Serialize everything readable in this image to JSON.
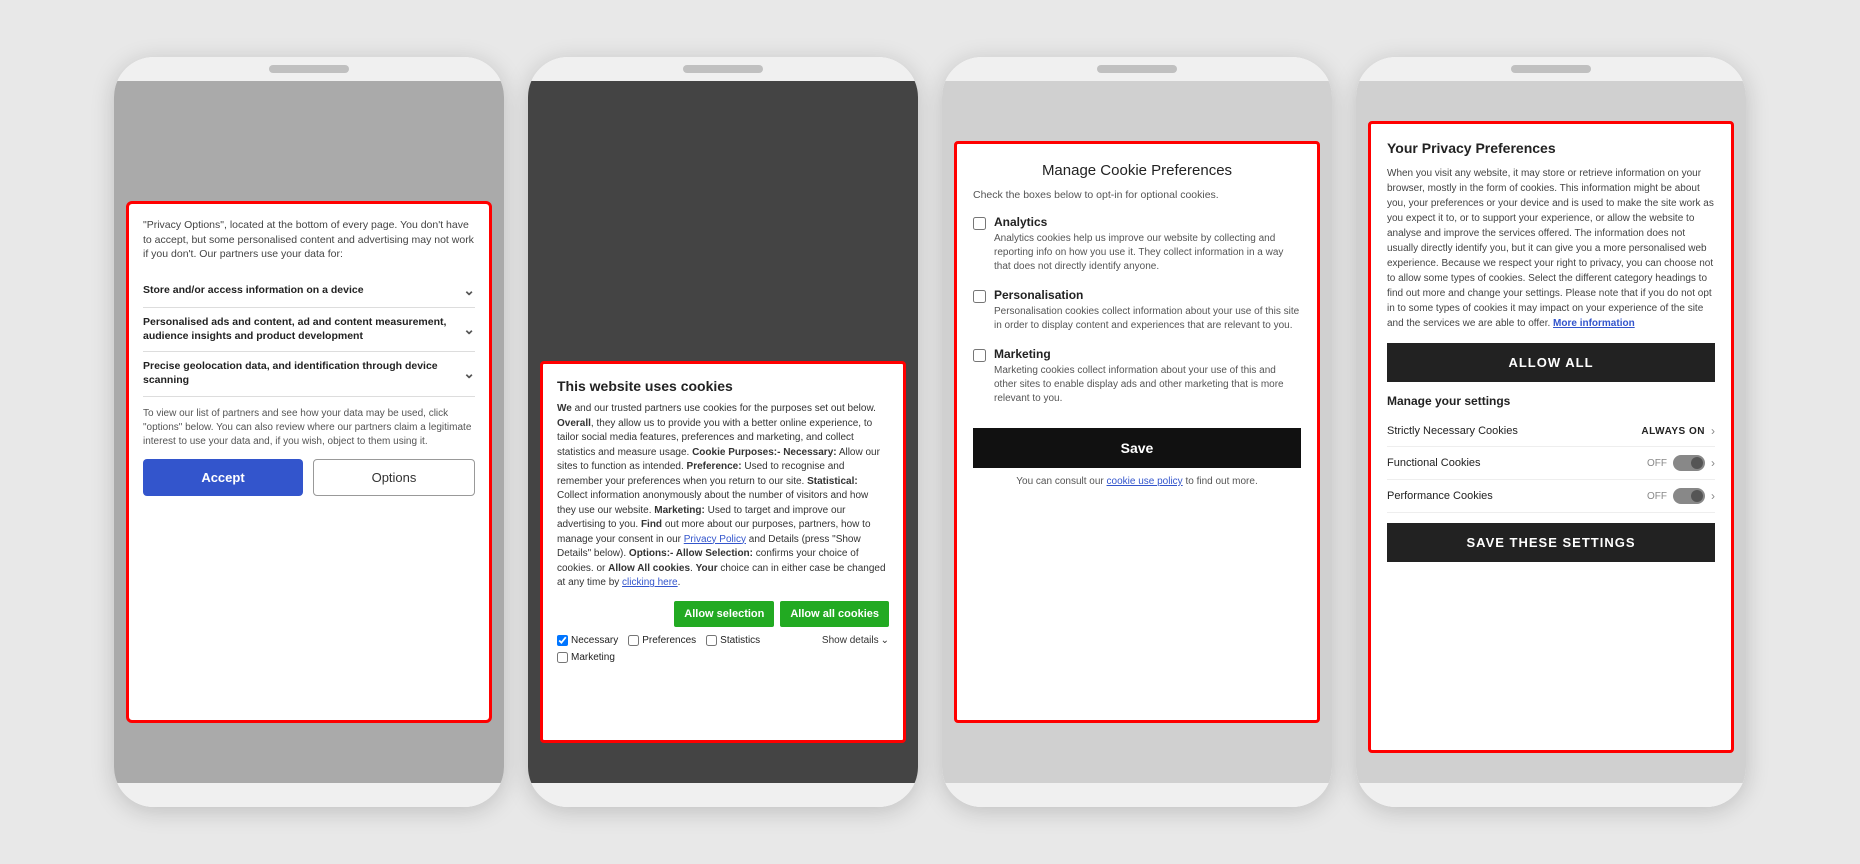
{
  "phone1": {
    "intro": "\"Privacy Options\", located at the bottom of every page. You don't have to accept, but some personalised content and advertising may not work if you don't. Our partners use your data for:",
    "items": [
      {
        "label": "Store and/or access information on a device"
      },
      {
        "label": "Personalised ads and content, ad and content measurement, audience insights and product development"
      },
      {
        "label": "Precise geolocation data, and identification through device scanning"
      }
    ],
    "footer": "To view our list of partners and see how your data may be used, click \"options\" below. You can also review where our partners claim a legitimate interest to use your data and, if you wish, object to them using it.",
    "accept_label": "Accept",
    "options_label": "Options"
  },
  "phone2": {
    "title": "This website uses cookies",
    "body": "We and our trusted partners use cookies for the purposes set out below. Overall, they allow us to provide you with a better online experience, to tailor social media features, preferences and marketing, and collect statistics and measure usage. Cookie Purposes:- Necessary: Allow our sites to function as intended. Preference: Used to recognise and remember your preferences when you return to our site. Statistical: Collect information anonymously about the number of visitors and how they use our website. Marketing: Used to target and improve our advertising to you. Find out more about our purposes, partners, how to manage your consent in our Privacy Policy and Details (press \"Show Details\" below). Options:- Allow Selection: confirms your choice of cookies. or Allow All cookies. Your choice can in either case be changed at any time by clicking here.",
    "privacy_link": "Privacy Policy",
    "clicking_link": "clicking here",
    "allow_selection_label": "Allow selection",
    "allow_all_label": "Allow all cookies",
    "checkboxes": [
      {
        "id": "necessary",
        "label": "Necessary",
        "checked": true
      },
      {
        "id": "preferences",
        "label": "Preferences",
        "checked": false
      },
      {
        "id": "statistics",
        "label": "Statistics",
        "checked": false
      },
      {
        "id": "marketing",
        "label": "Marketing",
        "checked": false
      }
    ],
    "show_details": "Show details"
  },
  "phone3": {
    "title": "Manage Cookie Preferences",
    "subtitle": "Check the boxes below to opt-in for optional cookies.",
    "options": [
      {
        "id": "analytics",
        "label": "Analytics",
        "desc": "Analytics cookies help us improve our website by collecting and reporting info on how you use it. They collect information in a way that does not directly identify anyone."
      },
      {
        "id": "personalisation",
        "label": "Personalisation",
        "desc": "Personalisation cookies collect information about your use of this site in order to display content and experiences that are relevant to you."
      },
      {
        "id": "marketing",
        "label": "Marketing",
        "desc": "Marketing cookies collect information about your use of this and other sites to enable display ads and other marketing that is more relevant to you."
      }
    ],
    "save_label": "Save",
    "consult_text": "You can consult our",
    "cookie_policy_link": "cookie use policy",
    "consult_suffix": "to find out more."
  },
  "phone4": {
    "title": "Your Privacy Preferences",
    "body": "When you visit any website, it may store or retrieve information on your browser, mostly in the form of cookies. This information might be about you, your preferences or your device and is used to make the site work as you expect it to, or to support your experience, or allow the website to analyse and improve the services offered. The information does not usually directly identify you, but it can give you a more personalised web experience. Because we respect your right to privacy, you can choose not to allow some types of cookies. Select the different category headings to find out more and change your settings. Please note that if you do not opt in to some types of cookies it may impact on your experience of the site and the services we are able to offer.",
    "more_info_link": "More information",
    "allow_all_label": "ALLOW ALL",
    "manage_heading": "Manage your settings",
    "toggles": [
      {
        "label": "Strictly Necessary Cookies",
        "status": "ALWAYS ON",
        "type": "badge"
      },
      {
        "label": "Functional Cookies",
        "status": "OFF",
        "type": "toggle"
      },
      {
        "label": "Performance Cookies",
        "status": "OFF",
        "type": "toggle"
      }
    ],
    "save_settings_label": "SAVE THESE SETTINGS"
  }
}
